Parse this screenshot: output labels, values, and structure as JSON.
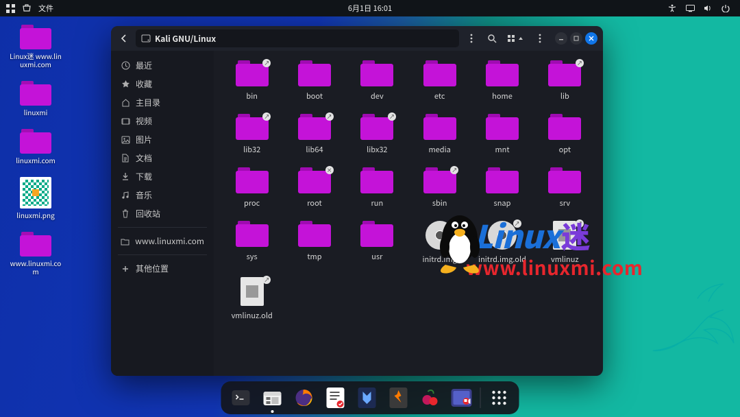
{
  "topbar": {
    "activities_icon": "apps",
    "app_icon": "places",
    "app_label": "文件",
    "clock": "6月1日  16:01"
  },
  "desktop": {
    "icons": [
      {
        "type": "folder",
        "label": "Linux迷 www.linuxmi.com"
      },
      {
        "type": "folder",
        "label": "linuxmi"
      },
      {
        "type": "folder",
        "label": "linuxmi.com"
      },
      {
        "type": "image",
        "label": "linuxmi.png"
      },
      {
        "type": "folder",
        "label": "www.linuxmi.com"
      }
    ]
  },
  "window": {
    "path_icon": "drive",
    "path": "Kali GNU/Linux",
    "sidebar": [
      {
        "icon": "clock",
        "label": "最近"
      },
      {
        "icon": "star",
        "label": "收藏"
      },
      {
        "icon": "home",
        "label": "主目录"
      },
      {
        "icon": "video",
        "label": "视频"
      },
      {
        "icon": "image",
        "label": "图片"
      },
      {
        "icon": "doc",
        "label": "文档"
      },
      {
        "icon": "download",
        "label": "下载"
      },
      {
        "icon": "music",
        "label": "音乐"
      },
      {
        "icon": "trash",
        "label": "回收站"
      },
      {
        "sep": true
      },
      {
        "icon": "folder",
        "label": "www.linuxmi.com"
      },
      {
        "sep": true
      },
      {
        "icon": "plus",
        "label": "其他位置"
      }
    ],
    "items": [
      {
        "type": "folder",
        "name": "bin",
        "link": true
      },
      {
        "type": "folder",
        "name": "boot"
      },
      {
        "type": "folder",
        "name": "dev"
      },
      {
        "type": "folder",
        "name": "etc"
      },
      {
        "type": "folder",
        "name": "home"
      },
      {
        "type": "folder",
        "name": "lib",
        "link": true
      },
      {
        "type": "folder",
        "name": "lib32",
        "link": true
      },
      {
        "type": "folder",
        "name": "lib64",
        "link": true
      },
      {
        "type": "folder",
        "name": "libx32",
        "link": true
      },
      {
        "type": "folder",
        "name": "media"
      },
      {
        "type": "folder",
        "name": "mnt"
      },
      {
        "type": "folder",
        "name": "opt"
      },
      {
        "type": "folder",
        "name": "proc"
      },
      {
        "type": "folder",
        "name": "root",
        "lock": true
      },
      {
        "type": "folder",
        "name": "run"
      },
      {
        "type": "folder",
        "name": "sbin",
        "link": true
      },
      {
        "type": "folder",
        "name": "snap"
      },
      {
        "type": "folder",
        "name": "srv"
      },
      {
        "type": "folder",
        "name": "sys"
      },
      {
        "type": "folder",
        "name": "tmp"
      },
      {
        "type": "folder",
        "name": "usr"
      },
      {
        "type": "disc",
        "name": "initrd.img",
        "link": true
      },
      {
        "type": "disc",
        "name": "initrd.img.old",
        "link": true
      },
      {
        "type": "file",
        "name": "vmlinuz",
        "link": true,
        "glyph": "win"
      },
      {
        "type": "file",
        "name": "vmlinuz.old",
        "link": true,
        "glyph": "recycle"
      }
    ]
  },
  "watermark": {
    "title_en": "Linux",
    "title_cn": "迷",
    "url": "www.linuxmi.com"
  },
  "dock": {
    "items": [
      {
        "name": "terminal",
        "bg": "#2d2f37"
      },
      {
        "name": "files",
        "bg": "#f2f2f2",
        "active": true
      },
      {
        "name": "firefox",
        "bg": "transparent"
      },
      {
        "name": "text-editor",
        "bg": "#ffffff"
      },
      {
        "name": "metasploit",
        "bg": "#1c2a52"
      },
      {
        "name": "burp",
        "bg": "#3a3a3a"
      },
      {
        "name": "cherrytree",
        "bg": "transparent"
      },
      {
        "name": "recorder",
        "bg": "#3b3f8e"
      }
    ],
    "grid_label": "show-apps"
  }
}
